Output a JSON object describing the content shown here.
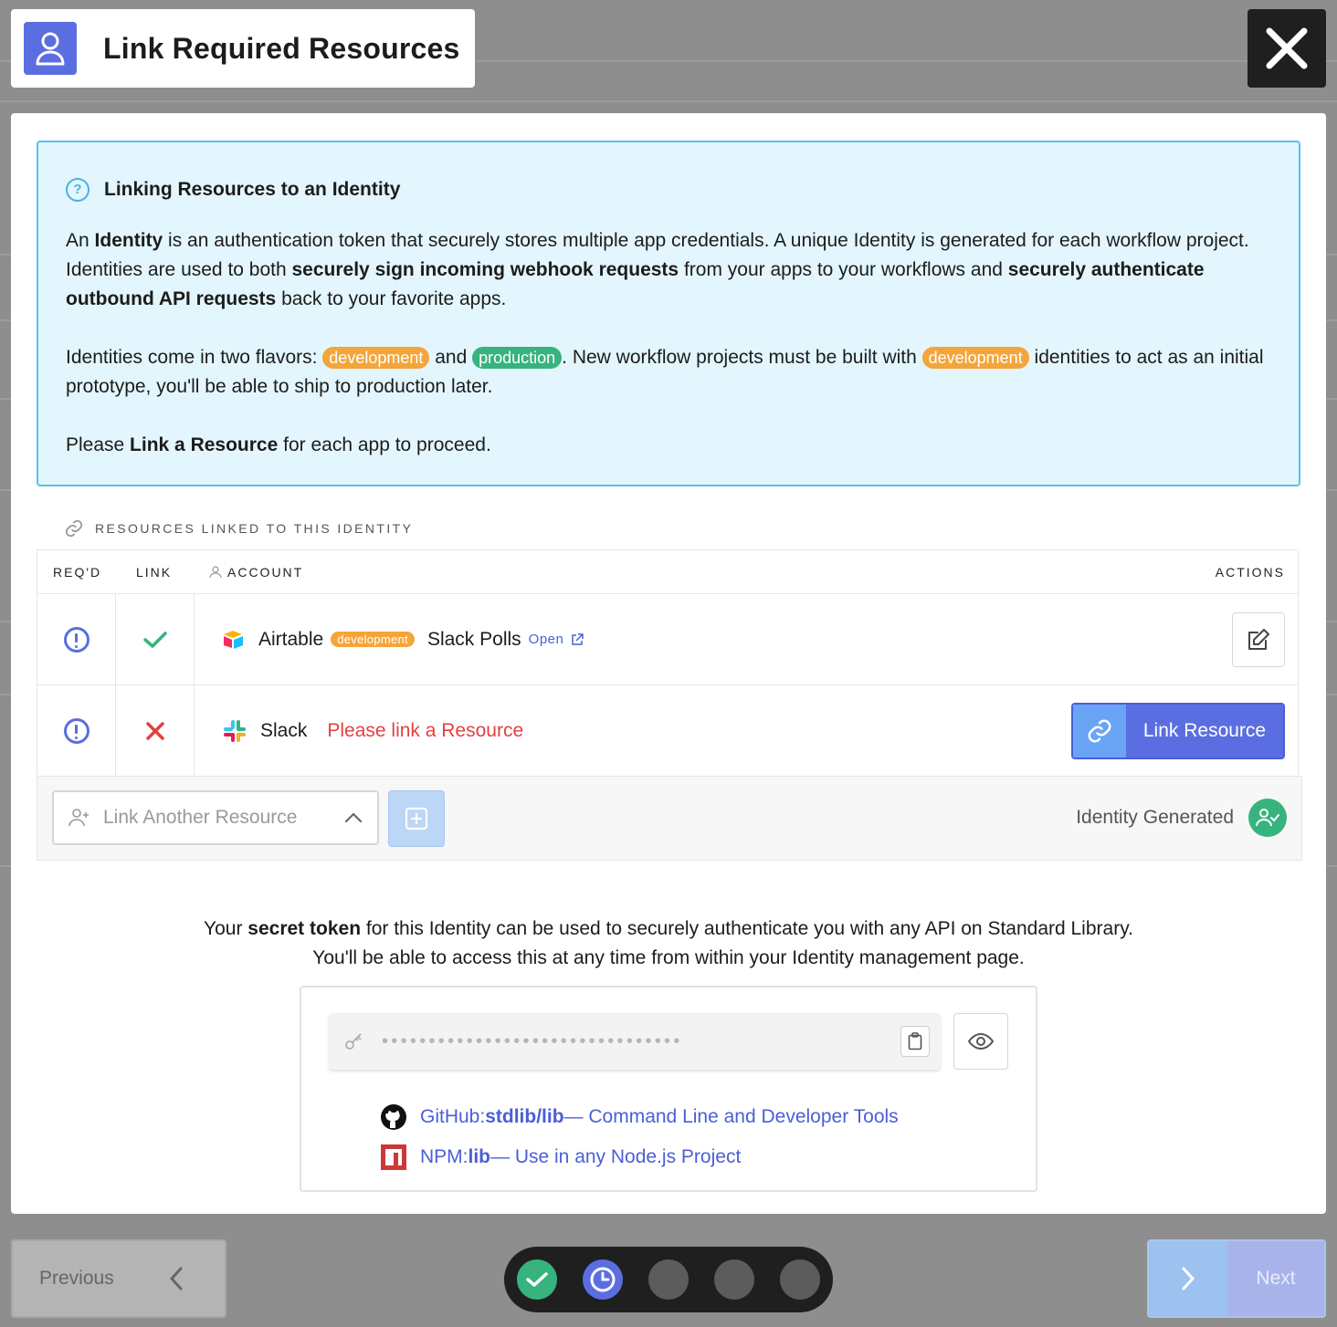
{
  "header": {
    "title": "Link Required Resources",
    "icon": "user-icon"
  },
  "info": {
    "heading": "Linking Resources to an Identity",
    "p1": {
      "t1": "An ",
      "b1": "Identity",
      "t2": " is an authentication token that securely stores multiple app credentials. A unique Identity is generated for each workflow project. Identities are used to both ",
      "b2": "securely sign incoming webhook requests",
      "t3": " from your apps to your workflows and ",
      "b3": "securely authenticate outbound API requests",
      "t4": " back to your favorite apps."
    },
    "p2": {
      "t1": "Identities come in two flavors: ",
      "pill_dev": "development",
      "t2": " and ",
      "pill_prod": "production",
      "t3": ". New workflow projects must be built with ",
      "pill_dev2": "development",
      "t4": " identities to act as an initial prototype, you'll be able to ship to production later."
    },
    "p3": {
      "t1": "Please ",
      "b1": "Link a Resource",
      "t2": " for each app to proceed."
    }
  },
  "resources": {
    "section_label": "RESOURCES LINKED TO THIS IDENTITY",
    "columns": {
      "req": "REQ'D",
      "link": "LINK",
      "account": "ACCOUNT",
      "actions": "ACTIONS"
    },
    "rows": [
      {
        "app": "Airtable",
        "env": "development",
        "account": "Slack Polls",
        "open": "Open",
        "linked": true
      },
      {
        "app": "Slack",
        "error": "Please link a Resource",
        "action": "Link Resource",
        "linked": false
      }
    ],
    "link_another_placeholder": "Link Another Resource",
    "identity_status": "Identity Generated"
  },
  "secret": {
    "l1a": "Your ",
    "l1b": "secret token",
    "l1c": " for this Identity can be used to securely authenticate you with any API on Standard Library.",
    "l2": "You'll be able to access this at any time from within your Identity management page.",
    "masked": "••••••••••••••••••••••••••••••••",
    "links": [
      {
        "prefix": "GitHub: ",
        "bold": "stdlib/lib",
        "suffix": " — Command Line and Developer Tools",
        "icon": "github-icon"
      },
      {
        "prefix": "NPM: ",
        "bold": "lib",
        "suffix": " — Use in any Node.js Project",
        "icon": "npm-icon"
      }
    ]
  },
  "nav": {
    "previous": "Previous",
    "next": "Next",
    "steps": [
      "done",
      "current",
      "pending",
      "pending",
      "pending"
    ]
  },
  "colors": {
    "accent": "#5b6ee1",
    "success": "#37b37e",
    "error": "#e34040",
    "dev": "#f4a53a",
    "info_bg": "#e3f6fd"
  }
}
